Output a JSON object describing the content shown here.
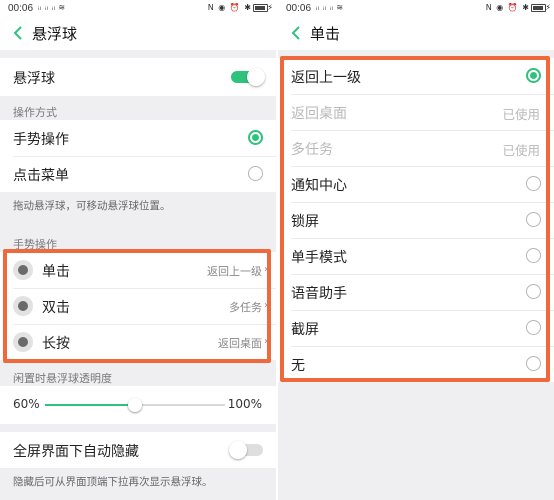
{
  "colors": {
    "accent": "#2fc27d",
    "highlight": "#f0693c"
  },
  "left": {
    "status": {
      "time": "00:06",
      "signal": "ᵢₗ ᵢₗ ᵢₗ ≋",
      "icons": "N ◉ ⏰ ✱"
    },
    "title": "悬浮球",
    "main_toggle": {
      "label": "悬浮球",
      "on": true
    },
    "mode_section": "操作方式",
    "modes": [
      {
        "label": "手势操作",
        "checked": true
      },
      {
        "label": "点击菜单",
        "checked": false
      }
    ],
    "mode_helper": "拖动悬浮球，可移动悬浮球位置。",
    "gesture_section": "手势操作",
    "gestures": [
      {
        "label": "单击",
        "value": "返回上一级",
        "icon": "gesture-dot-icon",
        "chevron": "›"
      },
      {
        "label": "双击",
        "value": "多任务",
        "icon": "gesture-dot-icon",
        "chevron": "›"
      },
      {
        "label": "长按",
        "value": "返回桌面",
        "icon": "gesture-dot-icon",
        "chevron": "›"
      }
    ],
    "opacity_section": "闲置时悬浮球透明度",
    "opacity": {
      "min_label": "60%",
      "max_label": "100%",
      "fraction": 0.5
    },
    "autohide": {
      "label": "全屏界面下自动隐藏",
      "on": false
    },
    "autohide_helper": "隐藏后可从界面顶端下拉再次显示悬浮球。"
  },
  "right": {
    "status": {
      "time": "00:06",
      "signal": "ᵢₗ ᵢₗ ᵢₗ ≋",
      "icons": "N ◉ ⏰ ✱"
    },
    "title": "单击",
    "options": [
      {
        "label": "返回上一级",
        "state": "checked"
      },
      {
        "label": "返回桌面",
        "state": "disabled",
        "note": "已使用"
      },
      {
        "label": "多任务",
        "state": "disabled",
        "note": "已使用"
      },
      {
        "label": "通知中心",
        "state": "unchecked"
      },
      {
        "label": "锁屏",
        "state": "unchecked"
      },
      {
        "label": "单手模式",
        "state": "unchecked"
      },
      {
        "label": "语音助手",
        "state": "unchecked"
      },
      {
        "label": "截屏",
        "state": "unchecked"
      },
      {
        "label": "无",
        "state": "unchecked"
      }
    ]
  }
}
